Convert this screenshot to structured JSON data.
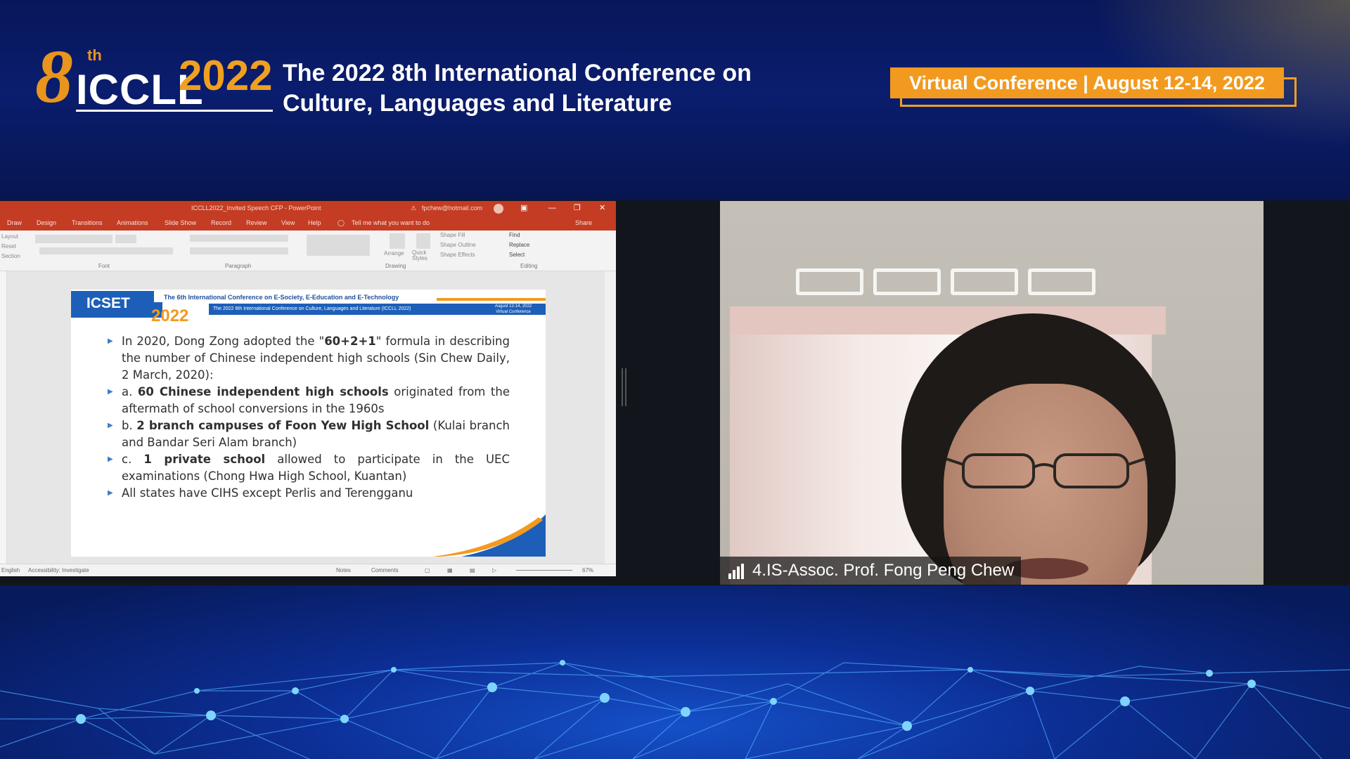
{
  "header": {
    "logo": {
      "ordinal_number": "8",
      "ordinal_suffix": "th",
      "acronym": "ICCLL",
      "year": "2022"
    },
    "title_line1": "The 2022 8th International Conference on",
    "title_line2": "Culture, Languages and Literature",
    "badge": "Virtual Conference | August 12-14, 2022"
  },
  "ppt": {
    "window_title": "ICCLL2022_Invited Speech CFP - PowerPoint",
    "warning_icon": "warning-icon",
    "user_email": "fpchew@hotmail.com",
    "menu": [
      "Draw",
      "Design",
      "Transitions",
      "Animations",
      "Slide Show",
      "Record",
      "Review",
      "View",
      "Help"
    ],
    "search_placeholder": "Tell me what you want to do",
    "share_label": "Share",
    "ribbon": {
      "groups": {
        "font": "Font",
        "paragraph": "Paragraph",
        "drawing": "Drawing",
        "editing": "Editing"
      },
      "layout": "Layout",
      "reset": "Reset",
      "section": "Section",
      "arrange": "Arrange",
      "quick_styles": "Quick Styles",
      "shape_fill": "Shape Fill",
      "shape_outline": "Shape Outline",
      "shape_effects": "Shape Effects",
      "find": "Find",
      "replace": "Replace",
      "select": "Select"
    },
    "status": {
      "language": "English",
      "accessibility": "Accessibility: Investigate",
      "notes": "Notes",
      "comments": "Comments",
      "zoom": "67%"
    },
    "slide": {
      "logo_text": "ICSET",
      "logo_year": "2022",
      "line1": "The 6th International Conference on E-Society, E-Education and E-Technology",
      "line2": "The 2022 8th International Conference on Culture, Languages and Literature (ICCLL 2022)",
      "date_line1": "August 12-14, 2022",
      "date_line2": "Virtual Conference",
      "bullets": [
        {
          "pre": "In 2020, Dong Zong adopted the \"",
          "bold": "60+2+1",
          "post": "\" formula in describing the number of Chinese independent high schools (Sin Chew Daily, 2 March, 2020):"
        },
        {
          "pre": "a. ",
          "bold": "60 Chinese independent high schools",
          "post": " originated from the aftermath of school conversions in the 1960s"
        },
        {
          "pre": "b. ",
          "bold": "2 branch campuses of Foon Yew High School",
          "post": " (Kulai branch and Bandar Seri Alam branch)"
        },
        {
          "pre": "c. ",
          "bold": "1 private school",
          "post": " allowed to participate in the UEC examinations (Chong Hwa High School, Kuantan)"
        },
        {
          "pre": "All states have CIHS except Perlis and Terengganu",
          "bold": "",
          "post": ""
        }
      ]
    }
  },
  "webcam": {
    "participant_label": "4.IS-Assoc. Prof. Fong Peng Chew",
    "signal_icon": "signal-strength-icon"
  },
  "colors": {
    "header_blue": "#0a1d6e",
    "accent_orange": "#f29a1f",
    "ppt_red": "#c43c23",
    "slide_blue": "#1d5fb8"
  }
}
